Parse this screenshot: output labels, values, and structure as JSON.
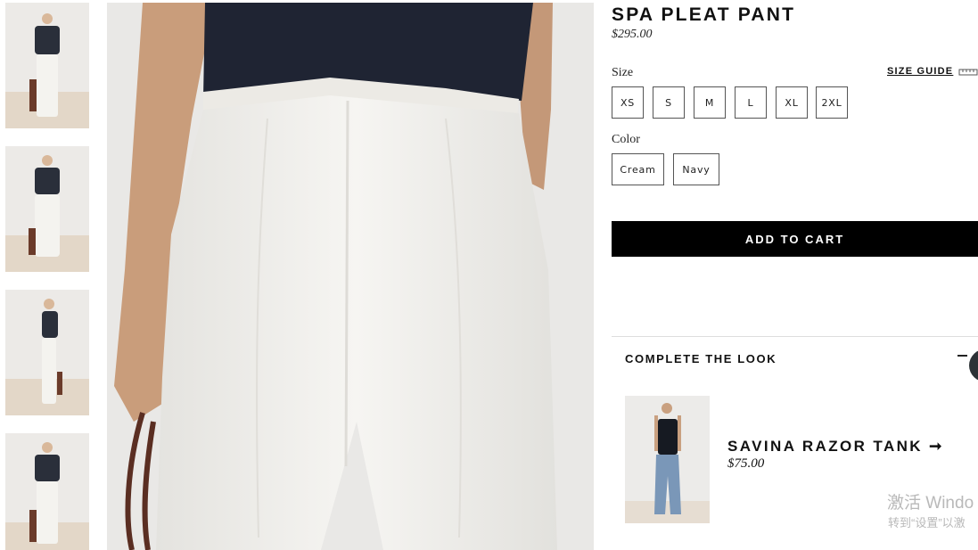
{
  "product": {
    "title": "SPA PLEAT PANT",
    "price": "$295.00"
  },
  "size": {
    "label": "Size",
    "guide_label": "SIZE GUIDE",
    "options": [
      "XS",
      "S",
      "M",
      "L",
      "XL",
      "2XL"
    ]
  },
  "color": {
    "label": "Color",
    "options": [
      "Cream",
      "Navy"
    ]
  },
  "cart": {
    "label": "ADD TO CART"
  },
  "complete_look": {
    "title": "COMPLETE THE LOOK",
    "item": {
      "name": "SAVINA RAZOR TANK",
      "arrow": "➞",
      "price": "$75.00"
    }
  },
  "watermark": {
    "line1": "激活 Windo",
    "line2": "转到“设置”以激"
  },
  "colors": {
    "accent": "#000000",
    "top_navy": "#1f2433",
    "pant_cream": "#f2f1ee",
    "floor_tan": "#e3d7c8"
  }
}
